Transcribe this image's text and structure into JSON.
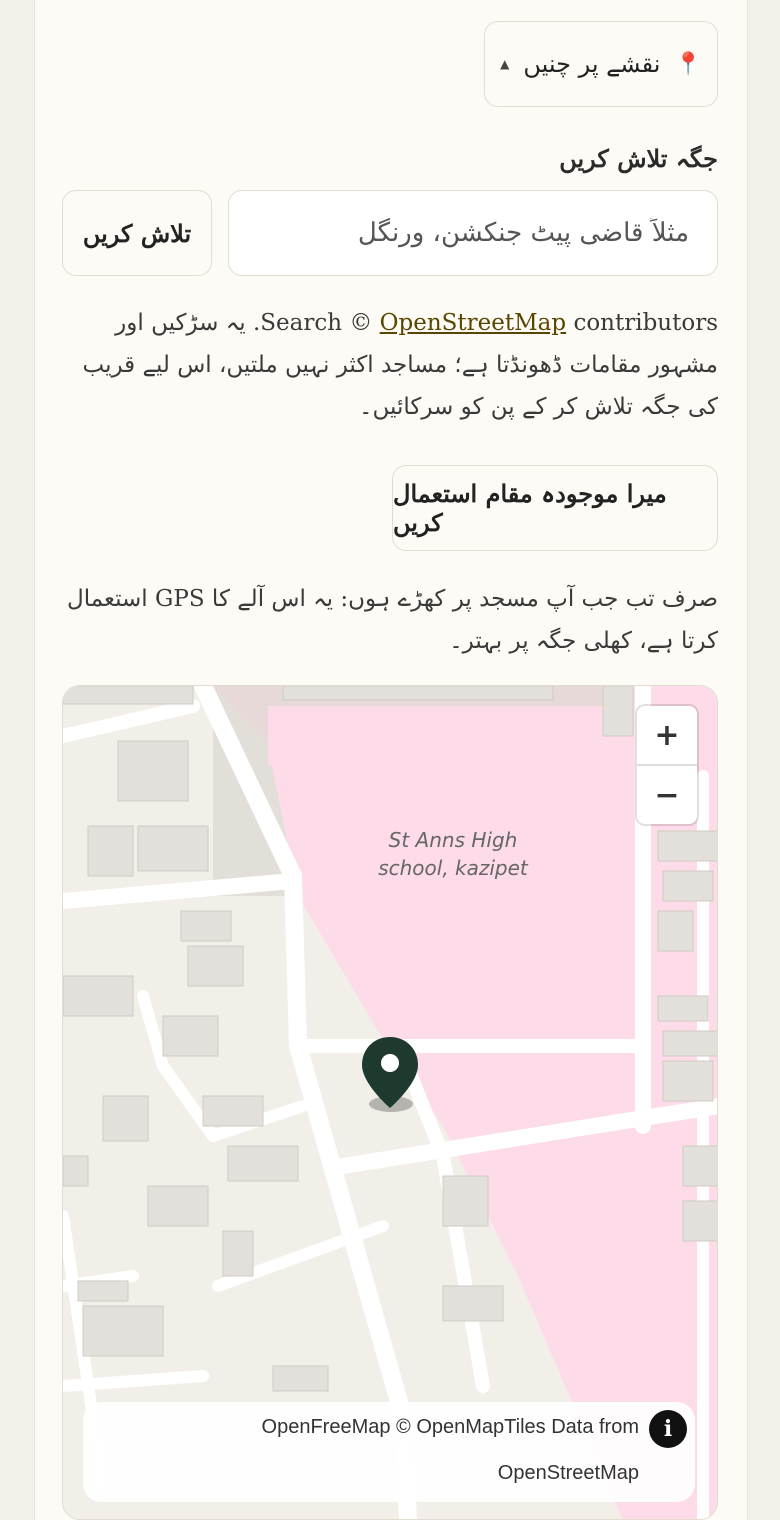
{
  "pick_on_map": {
    "label": "نقشے پر چنیں",
    "pin_icon": "map-pin-icon",
    "caret_icon": "caret-up-icon"
  },
  "search": {
    "heading": "جگہ تلاش کریں",
    "placeholder": "مثلاً قاضی پیٹ جنکشن، ورنگل",
    "value": "",
    "button": "تلاش کریں"
  },
  "search_note": {
    "prefix": "Search ©",
    "link": "OpenStreetMap",
    "suffix": "contributors. یہ سڑکیں اور مشہور مقامات ڈھونڈتا ہے؛ مساجد اکثر نہیں ملتیں، اس لیے قریب کی جگہ تلاش کر کے پن کو سرکائیں۔"
  },
  "location": {
    "button": "میرا موجودہ مقام استعمال کریں",
    "note": "صرف تب جب آپ مسجد پر کھڑے ہوں: یہ اس آلے کا GPS استعمال کرتا ہے، کھلی جگہ پر بہتر۔"
  },
  "map": {
    "place_label": [
      "St Anns High",
      "school, kazipet"
    ],
    "zoom_in": "+",
    "zoom_out": "−",
    "attribution_line1": "OpenFreeMap © OpenMapTiles Data from",
    "attribution_line2": "OpenStreetMap",
    "info": "i",
    "colors": {
      "land": "#f2efe9",
      "school": "#fddbe8",
      "building": "#e3e0dc",
      "road": "#ffffff",
      "marker": "#1e3a2f"
    }
  }
}
